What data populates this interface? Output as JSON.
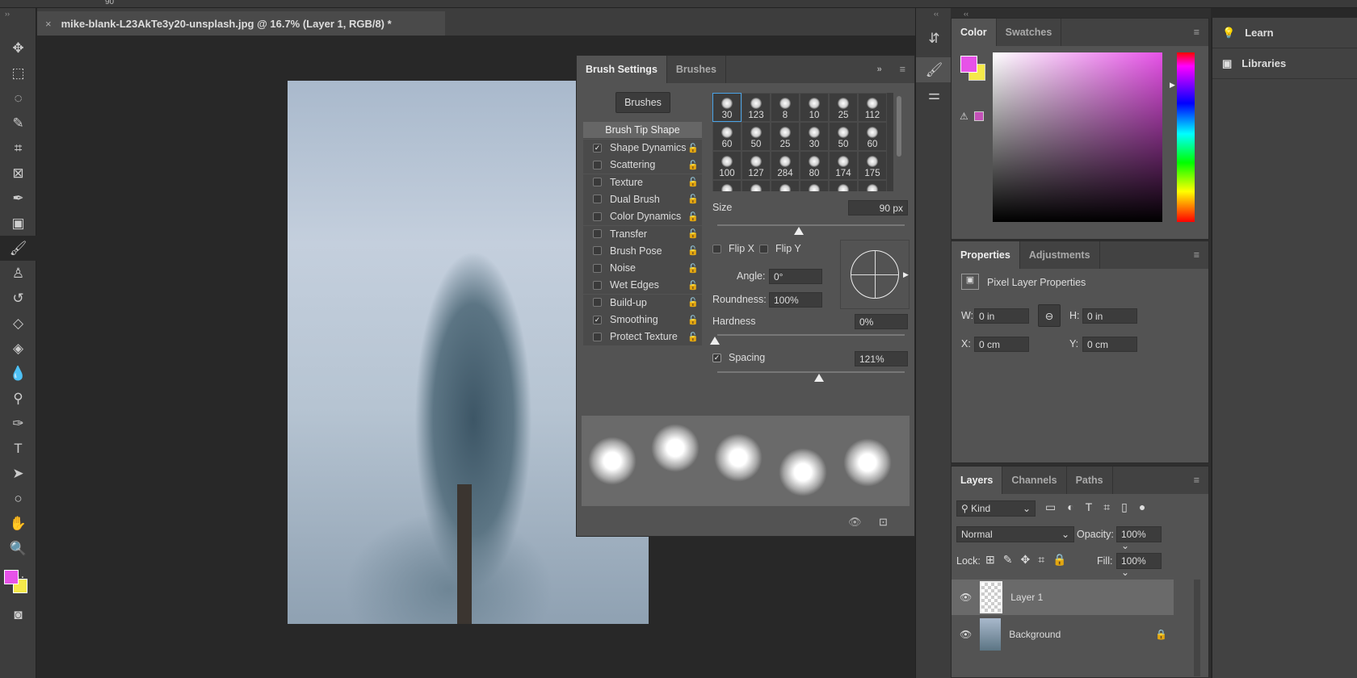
{
  "options_bar": {
    "value": "90"
  },
  "document": {
    "tab_title": "mike-blank-L23AkTe3y20-unsplash.jpg @ 16.7% (Layer 1, RGB/8) *"
  },
  "tools": [
    "move-icon",
    "marquee-icon",
    "lasso-icon",
    "quick-select-icon",
    "crop-icon",
    "frame-icon",
    "eyedropper-icon",
    "patch-icon",
    "brush-icon",
    "stamp-icon",
    "history-brush-icon",
    "eraser-icon",
    "paint-bucket-icon",
    "blur-icon",
    "dodge-icon",
    "pen-icon",
    "type-icon",
    "path-select-icon",
    "ellipse-icon",
    "hand-icon",
    "zoom-icon",
    "more-icon"
  ],
  "colors": {
    "foreground": "#e752e8",
    "background": "#f5e94a",
    "panel": "#535353",
    "selection": "#4aa3e6"
  },
  "brush_settings": {
    "tabs": [
      "Brush Settings",
      "Brushes"
    ],
    "brushes_button": "Brushes",
    "tip_shape": "Brush Tip Shape",
    "options": [
      {
        "label": "Shape Dynamics",
        "checked": true
      },
      {
        "label": "Scattering",
        "checked": false
      },
      {
        "label": "Texture",
        "checked": false
      },
      {
        "label": "Dual Brush",
        "checked": false
      },
      {
        "label": "Color Dynamics",
        "checked": false
      },
      {
        "label": "Transfer",
        "checked": false
      },
      {
        "label": "Brush Pose",
        "checked": false
      },
      {
        "label": "Noise",
        "checked": false
      },
      {
        "label": "Wet Edges",
        "checked": false
      },
      {
        "label": "Build-up",
        "checked": false
      },
      {
        "label": "Smoothing",
        "checked": true
      },
      {
        "label": "Protect Texture",
        "checked": false
      }
    ],
    "presets": [
      "30",
      "123",
      "8",
      "10",
      "25",
      "112",
      "60",
      "50",
      "25",
      "30",
      "50",
      "60",
      "100",
      "127",
      "284",
      "80",
      "174",
      "175"
    ],
    "size_label": "Size",
    "size": "90 px",
    "flip_x": "Flip X",
    "flip_y": "Flip Y",
    "angle_label": "Angle:",
    "angle": "0°",
    "roundness_label": "Roundness:",
    "roundness": "100%",
    "hardness_label": "Hardness",
    "hardness": "0%",
    "spacing_label": "Spacing",
    "spacing": "121%",
    "spacing_checked": true
  },
  "color_panel": {
    "tabs": [
      "Color",
      "Swatches"
    ]
  },
  "properties": {
    "tabs": [
      "Properties",
      "Adjustments"
    ],
    "title": "Pixel Layer Properties",
    "w_label": "W:",
    "w": "0 in",
    "h_label": "H:",
    "h": "0 in",
    "x_label": "X:",
    "x": "0 cm",
    "y_label": "Y:",
    "y": "0 cm"
  },
  "layers": {
    "tabs": [
      "Layers",
      "Channels",
      "Paths"
    ],
    "filter": "Kind",
    "blend_mode": "Normal",
    "opacity_label": "Opacity:",
    "opacity": "100%",
    "lock_label": "Lock:",
    "fill_label": "Fill:",
    "fill": "100%",
    "items": [
      "Layer 1",
      "Background"
    ]
  },
  "far_panel": {
    "items": [
      "Learn",
      "Libraries"
    ]
  }
}
